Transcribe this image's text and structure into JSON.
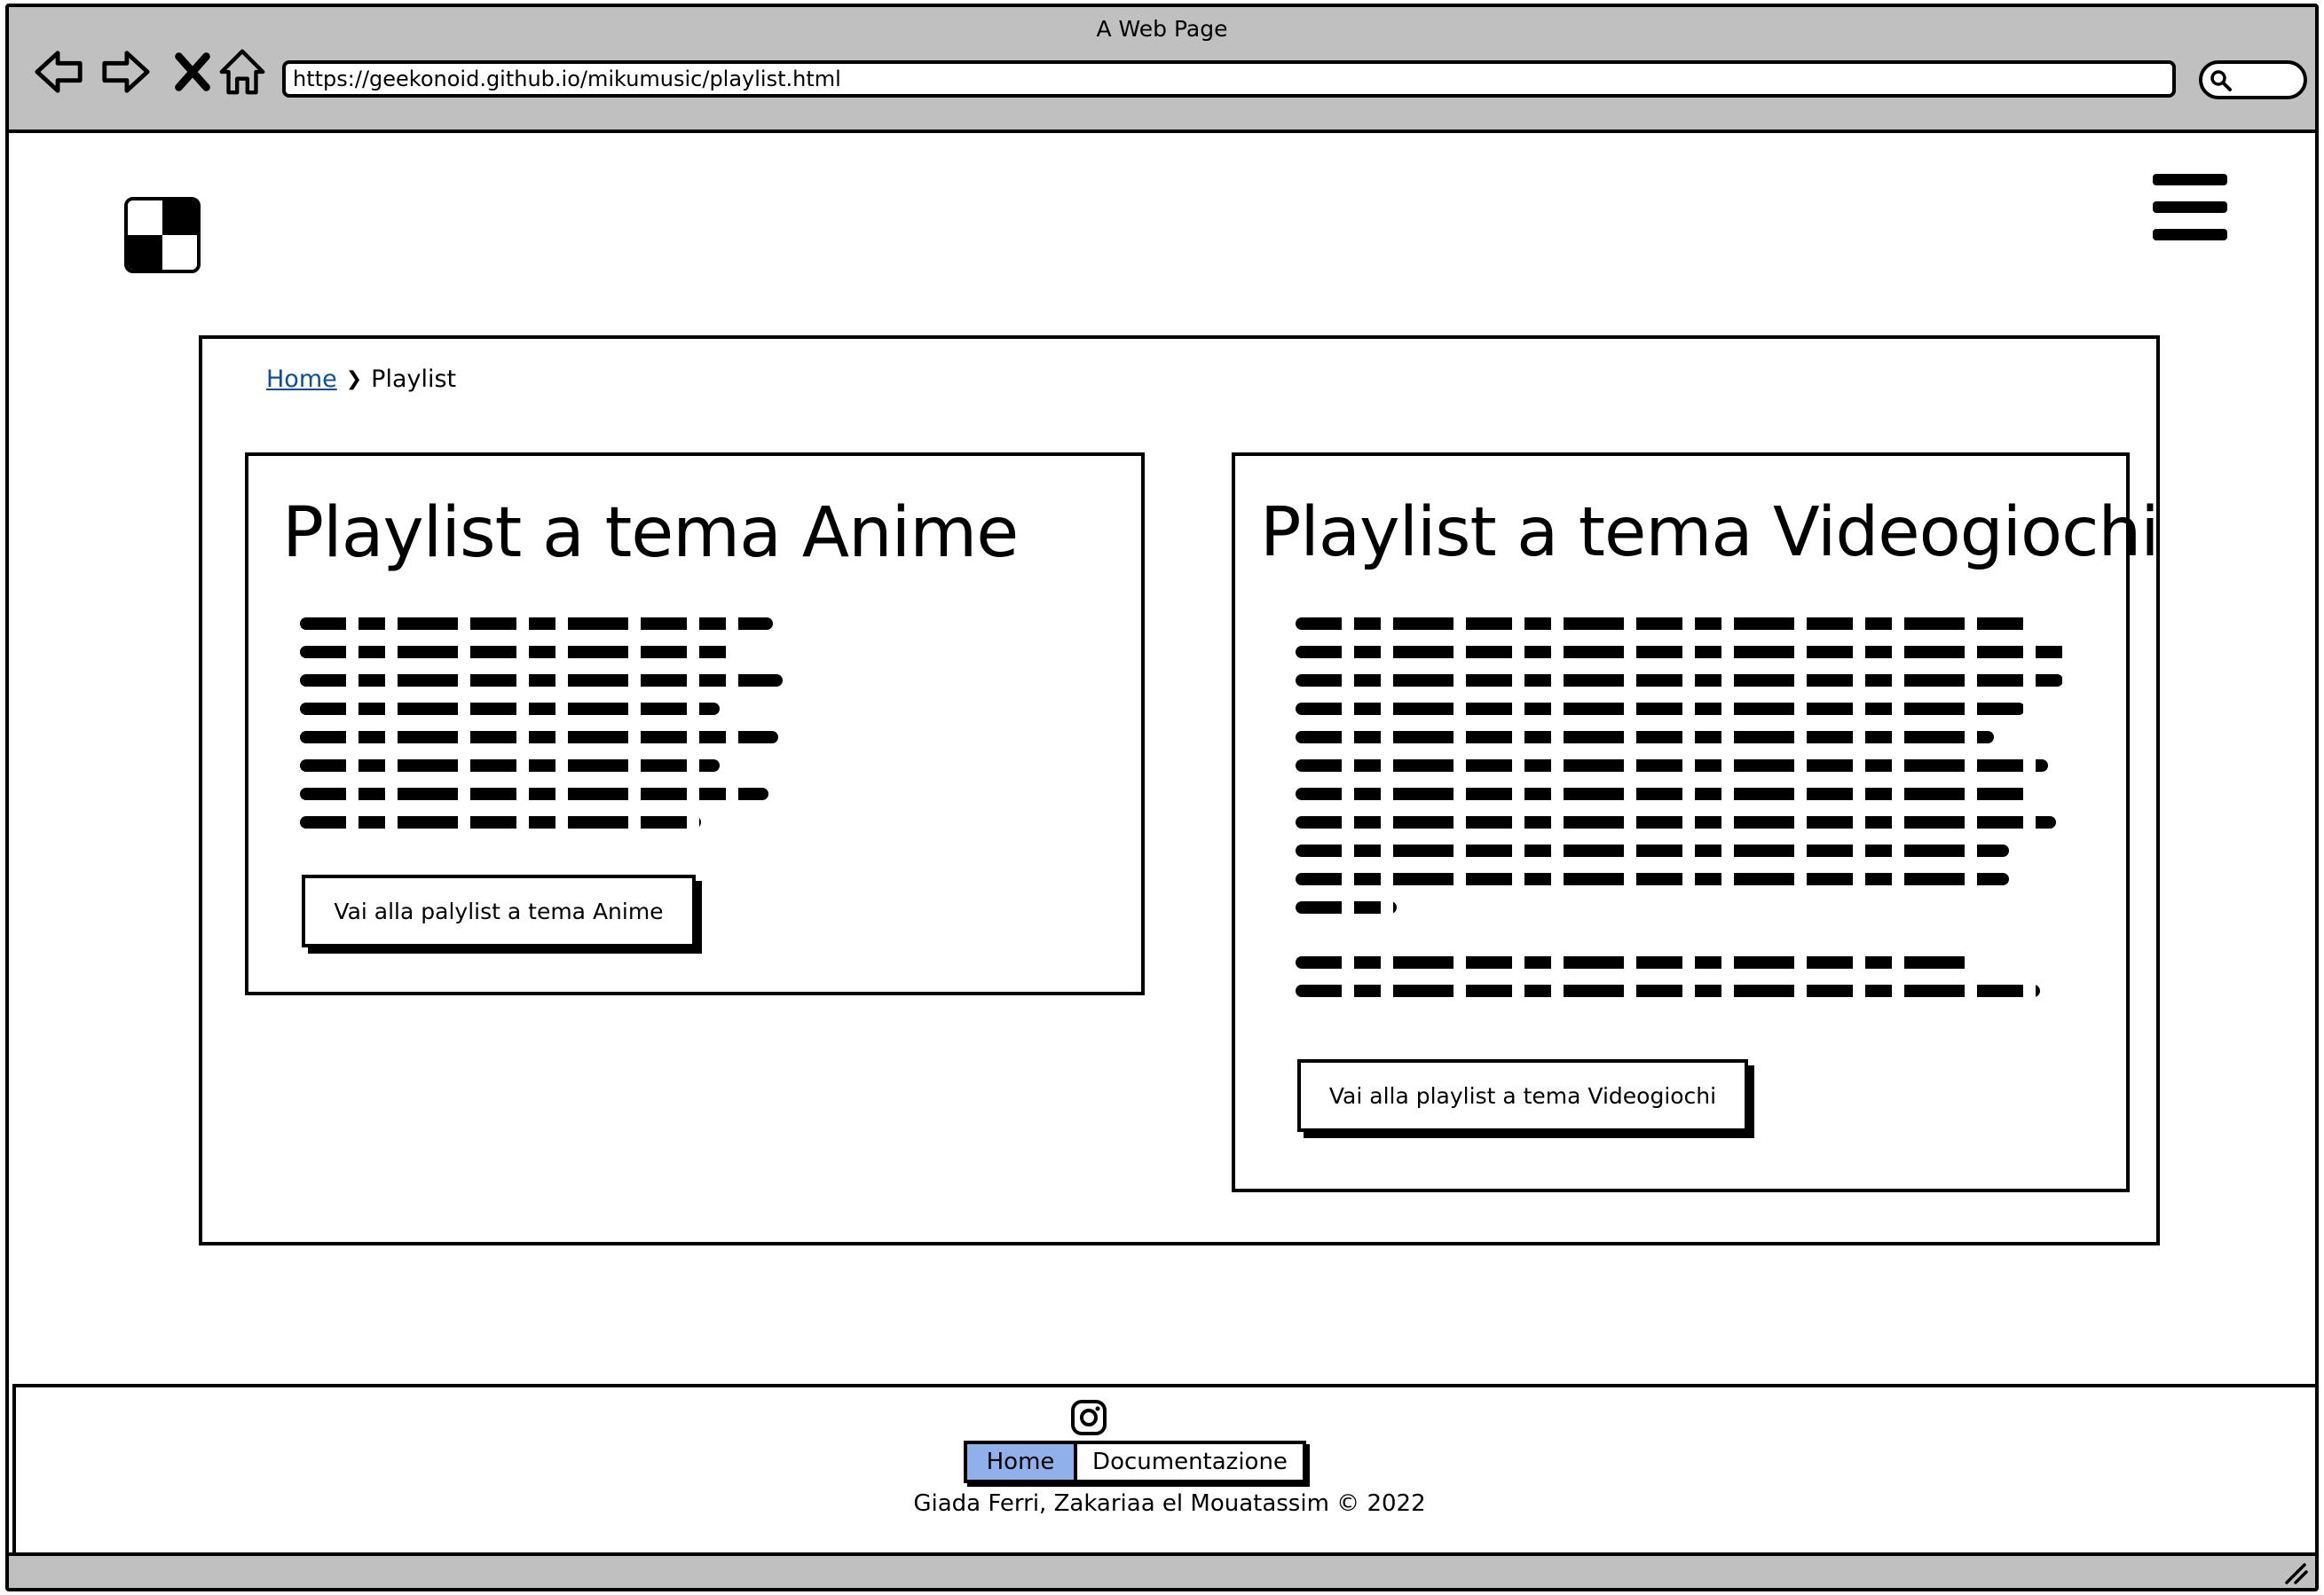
{
  "browser": {
    "window_title": "A Web Page",
    "url": "https://geekonoid.github.io/mikumusic/playlist.html",
    "icons": [
      "back-arrow-icon",
      "forward-arrow-icon",
      "close-icon",
      "home-icon",
      "search-icon"
    ]
  },
  "breadcrumb": {
    "home_label": "Home",
    "current_label": "Playlist"
  },
  "cards": [
    {
      "title": "Playlist a tema Anime",
      "button_label": "Vai alla palylist a tema Anime"
    },
    {
      "title": "Playlist a tema Videogiochi",
      "button_label": "Vai alla playlist a tema Videogiochi"
    }
  ],
  "footer": {
    "icon": "instagram-icon",
    "nav": [
      "Home",
      "Documentazione"
    ],
    "active_nav": "Home",
    "copyright": "Giada Ferri, Zakariaa el Mouatassim © 2022"
  },
  "colors": {
    "chrome_gray": "#c0c0c0",
    "link_blue": "#0b4fa0",
    "active_tab": "#8fb0ea"
  }
}
